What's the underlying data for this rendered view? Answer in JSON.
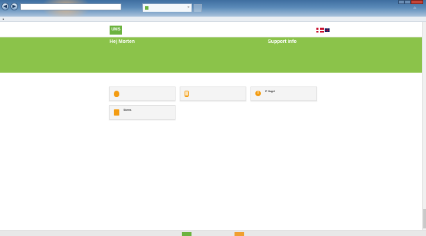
{
  "browser": {
    "address_url": "",
    "address_actions": "",
    "tab_title": "",
    "favorites": {
      "convert": "",
      "select": ""
    }
  },
  "header": {
    "logo_text": "UMS",
    "brand": "",
    "address": ""
  },
  "banner": {
    "greeting": "Hej Morten",
    "greeting_line1": "",
    "greeting_line2": "",
    "support_title": "Support info",
    "support_line1": "",
    "support_line2": ""
  },
  "functions": {
    "title": "",
    "cards": [
      {
        "title": "",
        "desc": "",
        "icon": "password-icon"
      },
      {
        "title": "",
        "desc": "",
        "icon": "mobile-icon"
      },
      {
        "title": "IT Hugel",
        "desc": "",
        "icon": "it-alert-icon"
      },
      {
        "title": "Skema",
        "desc": "",
        "icon": "print-icon"
      }
    ]
  },
  "footer": {
    "text": ""
  },
  "colors": {
    "brand_green": "#8bc34a",
    "logo_green": "#6cb33f",
    "accent_orange": "#f39c12"
  }
}
